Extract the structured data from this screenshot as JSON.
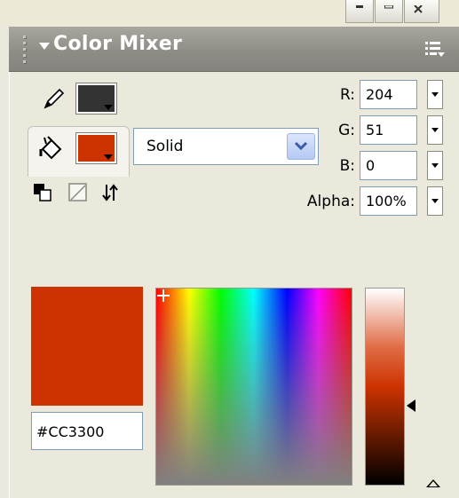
{
  "panel": {
    "title": "Color Mixer",
    "icons": {
      "collapse": "triangle-down-icon",
      "options": "options-menu-icon",
      "grip": "grip-icon"
    }
  },
  "stroke": {
    "color": "#333333",
    "icon": "pencil-icon"
  },
  "fill": {
    "color": "#CC3300",
    "icon": "paint-bucket-icon"
  },
  "fill_type": {
    "selected": "Solid"
  },
  "rgb": {
    "r_label": "R:",
    "r_value": "204",
    "g_label": "G:",
    "g_value": "51",
    "b_label": "B:",
    "b_value": "0",
    "alpha_label": "Alpha:",
    "alpha_value": "100%"
  },
  "hex": {
    "value": "#CC3300"
  },
  "colors": {
    "current": "#CC3300",
    "stroke": "#333333"
  }
}
